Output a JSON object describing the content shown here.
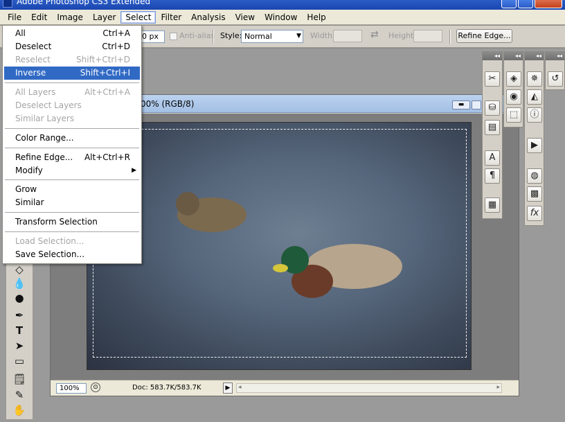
{
  "app": {
    "title": "Adobe Photoshop CS3 Extended"
  },
  "menubar": {
    "items": [
      "File",
      "Edit",
      "Image",
      "Layer",
      "Select",
      "Filter",
      "Analysis",
      "View",
      "Window",
      "Help"
    ],
    "active": "Select"
  },
  "options": {
    "feather_value": "0 px",
    "antialias_label": "Anti-alias",
    "style_label": "Style:",
    "style_value": "Normal",
    "width_label": "Width:",
    "height_label": "Height:",
    "refine_edge_label": "Refine Edge..."
  },
  "document": {
    "title": "00% (RGB/8)",
    "zoom": "100%",
    "doc_info": "Doc: 583.7K/583.7K"
  },
  "select_menu": {
    "all": {
      "label": "All",
      "shortcut": "Ctrl+A"
    },
    "deselect": {
      "label": "Deselect",
      "shortcut": "Ctrl+D"
    },
    "reselect": {
      "label": "Reselect",
      "shortcut": "Shift+Ctrl+D"
    },
    "inverse": {
      "label": "Inverse",
      "shortcut": "Shift+Ctrl+I"
    },
    "all_layers": {
      "label": "All Layers",
      "shortcut": "Alt+Ctrl+A"
    },
    "deselect_layers": {
      "label": "Deselect Layers"
    },
    "similar_layers": {
      "label": "Similar Layers"
    },
    "color_range": {
      "label": "Color Range..."
    },
    "refine_edge": {
      "label": "Refine Edge...",
      "shortcut": "Alt+Ctrl+R"
    },
    "modify": {
      "label": "Modify"
    },
    "grow": {
      "label": "Grow"
    },
    "similar": {
      "label": "Similar"
    },
    "transform_selection": {
      "label": "Transform Selection"
    },
    "load_selection": {
      "label": "Load Selection..."
    },
    "save_selection": {
      "label": "Save Selection..."
    }
  },
  "icons": {
    "panel_collapse": "◂◂",
    "submenu_arrow": "▶",
    "dropdown_arrow": "▼",
    "play": "▶",
    "scroll_left": "◂",
    "scroll_right": "▸"
  }
}
